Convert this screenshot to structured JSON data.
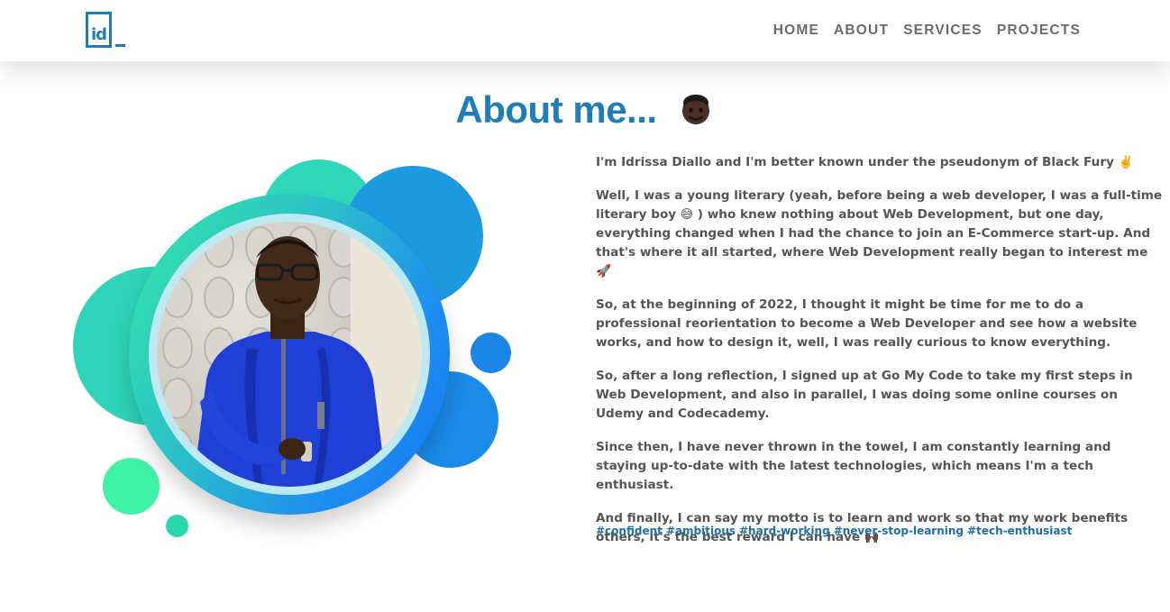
{
  "header": {
    "logo_text": "id",
    "nav": [
      {
        "label": "HOME"
      },
      {
        "label": "ABOUT"
      },
      {
        "label": "SERVICES"
      },
      {
        "label": "PROJECTS"
      }
    ]
  },
  "about": {
    "title": "About me...",
    "title_icon": "man-face-emoji",
    "paragraphs": [
      "I'm Idrissa Diallo and I'm better known under the pseudonym of Black Fury ✌️",
      "Well, I was a young literary (yeah, before being a web developer, I was a full-time literary boy 😅 ) who knew nothing about Web Development, but one day, everything changed when I had the chance to join an E-Commerce start-up. And that's where it all started, where Web Development really began to interest me 🚀",
      "So, at the beginning of 2022, I thought it might be time for me to do a professional reorientation to become a Web Developer and see how a website works, and how to design it, well, I was really curious to know everything.",
      "So, after a long reflection, I signed up at Go My Code to take my first steps in Web Development, and also in parallel, I was doing some online courses on Udemy and Codecademy.",
      "Since then, I have never thrown in the towel, I am constantly learning and staying up-to-date with the latest technologies, which means I'm a tech enthusiast.",
      "And finally, I can say my motto is to learn and work so that my work benefits others, it's the best reward I can have 🙌🏿"
    ],
    "tags": [
      "#confident",
      "#ambitious",
      "#hard-working",
      "#never-stop-learning",
      "#tech-enthusiast"
    ]
  },
  "colors": {
    "accent": "#1f7db8",
    "nav_text": "#6b6b6b",
    "body_text": "#555555",
    "tag_text": "#1f6fa6",
    "bubble_teal": "#2fd6b4",
    "bubble_blue": "#1e9be0",
    "bubble_green": "#3cf0a4"
  }
}
